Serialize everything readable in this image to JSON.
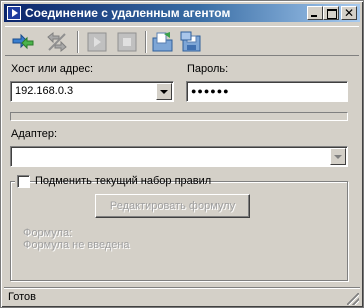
{
  "window": {
    "title": "Соединение с удаленным агентом"
  },
  "toolbar": {
    "icons": [
      "connect-icon",
      "disconnect-icon",
      "play-icon",
      "stop-icon",
      "open-folder-icon",
      "save-icon"
    ]
  },
  "form": {
    "host_label": "Хост или адрес:",
    "host_value": "192.168.0.3",
    "password_label": "Пароль:",
    "password_value": "●●●●●●",
    "adapter_label": "Адаптер:",
    "adapter_value": "",
    "replace_rules_label": "Подменить текущий набор правил",
    "replace_rules_checked": false,
    "edit_formula_button": "Редактировать формулу",
    "formula_label": "Формула:",
    "formula_value": "Формула не введена"
  },
  "status": {
    "text": "Готов"
  },
  "colors": {
    "title_start": "#0a246a",
    "title_end": "#a6caf0",
    "face": "#d4d0c8"
  }
}
